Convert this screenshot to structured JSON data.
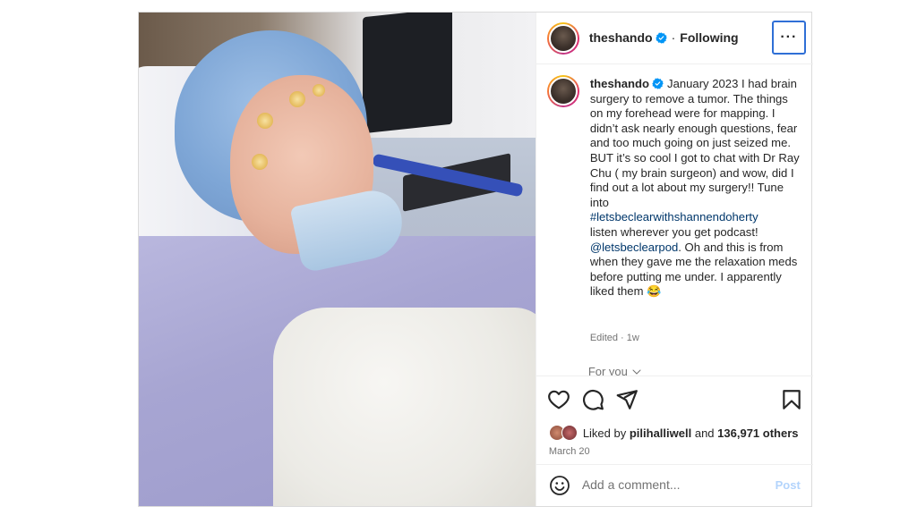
{
  "post": {
    "username": "theshando",
    "follow_status": "Following",
    "separator": "·",
    "more_label": "···",
    "caption_text": "January 2023 I had brain surgery to remove a tumor. The things on my forehead were for mapping. I didn’t ask nearly enough questions, fear and too much going on just seized me. BUT it’s so cool I got to chat with Dr Ray Chu ( my brain surgeon) and wow, did I find out a lot about my surgery!! Tune into",
    "hashtag": "#letsbeclearwithshannendoherty",
    "caption_mid": "listen wherever you get podcast!",
    "mention": "@letsbeclearpod",
    "caption_end": ". Oh and this is from when they gave me the relaxation meds before putting me under. I apparently liked them 😂",
    "edited_meta": "Edited · 1w",
    "for_you": "For you",
    "liked_prefix": "Liked by",
    "liked_by_user": "pilihalliwell",
    "liked_and": "and",
    "liked_others": "136,971 others",
    "date": "March 20",
    "comment_placeholder": "Add a comment...",
    "post_button": "Post"
  },
  "icons": {
    "like": "heart-icon",
    "comment": "comment-icon",
    "share": "send-icon",
    "save": "bookmark-icon",
    "emoji": "emoji-icon",
    "verified": "verified-badge-icon",
    "chevron": "chevron-down-icon"
  },
  "colors": {
    "link": "#00376b",
    "verified": "#0095f6",
    "muted": "#737373",
    "post_disabled": "#b3d4fc"
  }
}
